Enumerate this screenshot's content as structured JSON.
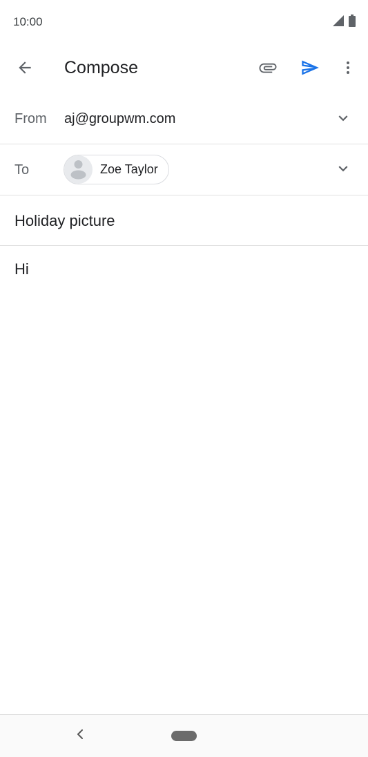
{
  "status_bar": {
    "time": "10:00",
    "icons": [
      "signal-icon",
      "battery-icon"
    ]
  },
  "app_bar": {
    "title": "Compose",
    "actions": [
      "back-arrow-icon",
      "paperclip-icon",
      "send-icon",
      "more-vert-icon"
    ],
    "send_color": "#1a73e8"
  },
  "compose": {
    "from_label": "From",
    "from_value": "aj@groupwm.com",
    "to_label": "To",
    "to_recipient": "Zoe Taylor",
    "subject": "Holiday picture",
    "body": "Hi"
  },
  "nav_bar": {
    "icons": [
      "nav-back-icon",
      "nav-home-pill"
    ]
  }
}
